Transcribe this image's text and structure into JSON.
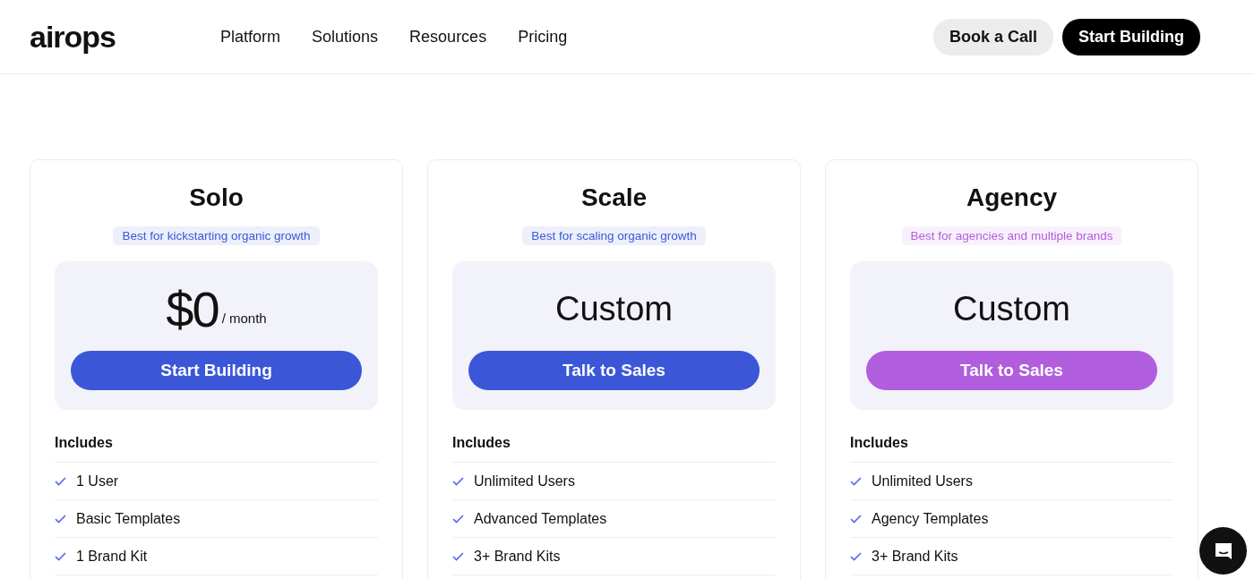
{
  "header": {
    "logo": "airops",
    "nav": [
      "Platform",
      "Solutions",
      "Resources",
      "Pricing"
    ],
    "buttons": [
      "Book a Call",
      "Start Building"
    ]
  },
  "plans": [
    {
      "name": "Solo",
      "tagline": "Best for kickstarting organic growth",
      "color": "#3b57d8",
      "price": "$0",
      "period": "/ month",
      "cta": "Start Building",
      "includes_label": "Includes",
      "features": [
        "1 User",
        "Basic Templates",
        "1 Brand Kit"
      ]
    },
    {
      "name": "Scale",
      "tagline": "Best for scaling organic growth",
      "color": "#3b57d8",
      "price": "Custom",
      "cta": "Talk to Sales",
      "includes_label": "Includes",
      "features": [
        "Unlimited Users",
        "Advanced Templates",
        "3+ Brand Kits"
      ]
    },
    {
      "name": "Agency",
      "tagline": "Best for agencies and multiple brands",
      "color": "#b05ede",
      "price": "Custom",
      "cta": "Talk to Sales",
      "includes_label": "Includes",
      "features": [
        "Unlimited Users",
        "Agency Templates",
        "3+ Brand Kits"
      ]
    }
  ]
}
